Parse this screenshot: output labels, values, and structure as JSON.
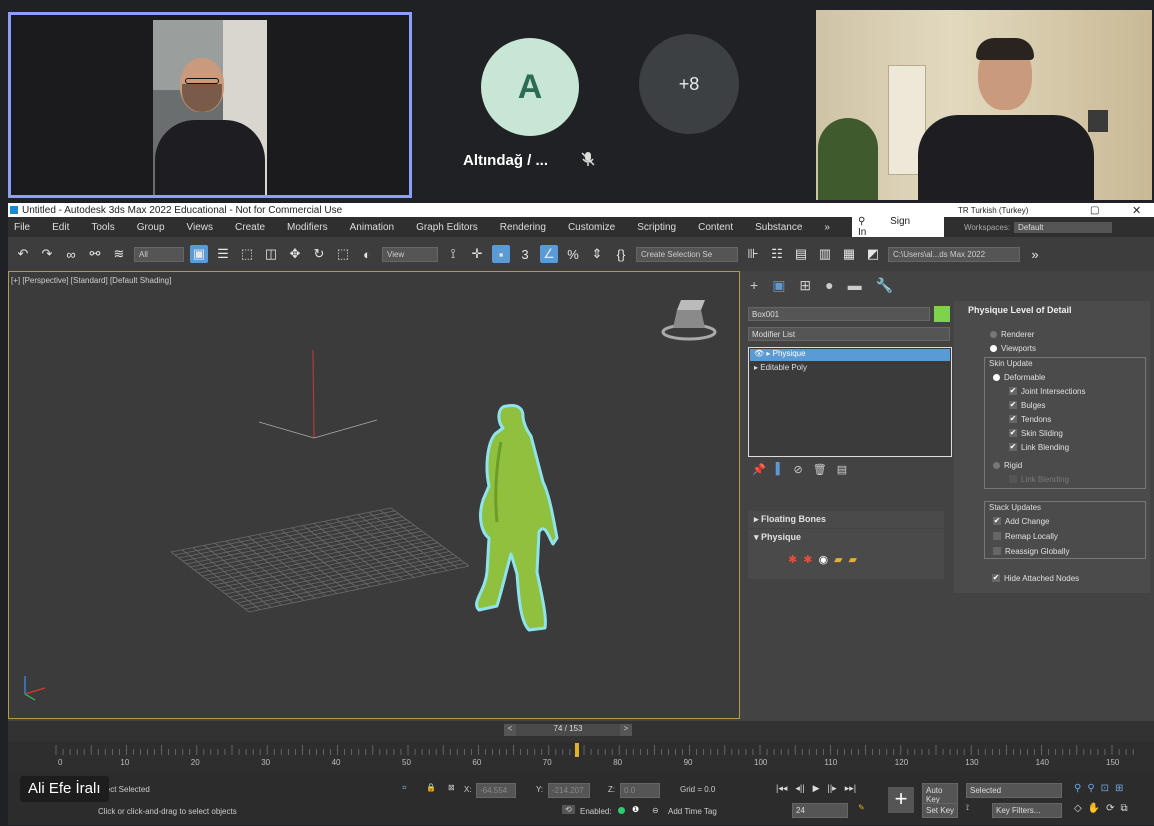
{
  "meeting": {
    "participant_a_initial": "A",
    "participant_a_name": "Altındağ / ...",
    "more_count": "+8",
    "bottom_name": "Ali Efe İralı"
  },
  "app": {
    "title": "Untitled - Autodesk 3ds Max 2022 Educational - Not for Commercial Use",
    "language": "TR Turkish (Turkey)",
    "menu": [
      "File",
      "Edit",
      "Tools",
      "Group",
      "Views",
      "Create",
      "Modifiers",
      "Animation",
      "Graph Editors",
      "Rendering",
      "Customize",
      "Scripting",
      "Content",
      "Substance",
      "»"
    ],
    "sign_in": "Sign In",
    "workspaces_label": "Workspaces:",
    "workspaces_value": "Default",
    "filter_all": "All",
    "view_dropdown": "View",
    "create_selection": "Create Selection Se",
    "path": "C:\\Users\\al...ds Max 2022",
    "viewport_label": "[+] [Perspective] [Standard] [Default Shading]"
  },
  "command_panel": {
    "object_name": "Box001",
    "modifier_list": "Modifier List",
    "stack": [
      "Physique",
      "Editable Poly"
    ],
    "rollouts": [
      "Floating Bones",
      "Physique"
    ]
  },
  "physique_lod": {
    "title": "Physique Level of Detail",
    "renderer": "Renderer",
    "viewports": "Viewports",
    "skin_update": "Skin Update",
    "deformable": "Deformable",
    "deformable_opts": [
      "Joint Intersections",
      "Bulges",
      "Tendons",
      "Skin Sliding",
      "Link Blending"
    ],
    "rigid": "Rigid",
    "rigid_link": "Link Blending",
    "stack_updates": "Stack Updates",
    "stack_opts": [
      "Add Change",
      "Remap Locally",
      "Reassign Globally"
    ],
    "stack_checked": [
      true,
      false,
      false
    ],
    "hide_nodes": "Hide Attached Nodes"
  },
  "timeline": {
    "frame": "74 / 153",
    "ticks": [
      "0",
      "10",
      "20",
      "30",
      "40",
      "50",
      "60",
      "70",
      "80",
      "90",
      "100",
      "110",
      "120",
      "130",
      "140",
      "150"
    ],
    "current_frame_value": 74,
    "max_frame": 153
  },
  "status": {
    "selected": "ject Selected",
    "prompt": "Click or click-and-drag to select objects",
    "x_label": "X:",
    "x_value": "-64.554",
    "y_label": "Y:",
    "y_value": "-214.207",
    "z_label": "Z:",
    "z_value": "0.0",
    "grid": "Grid = 0.0",
    "enabled": "Enabled:",
    "add_time_tag": "Add Time Tag",
    "auto_key": "Auto Key",
    "set_key": "Set Key",
    "selected_dropdown": "Selected",
    "key_filters": "Key Filters...",
    "frame_box": "24"
  }
}
